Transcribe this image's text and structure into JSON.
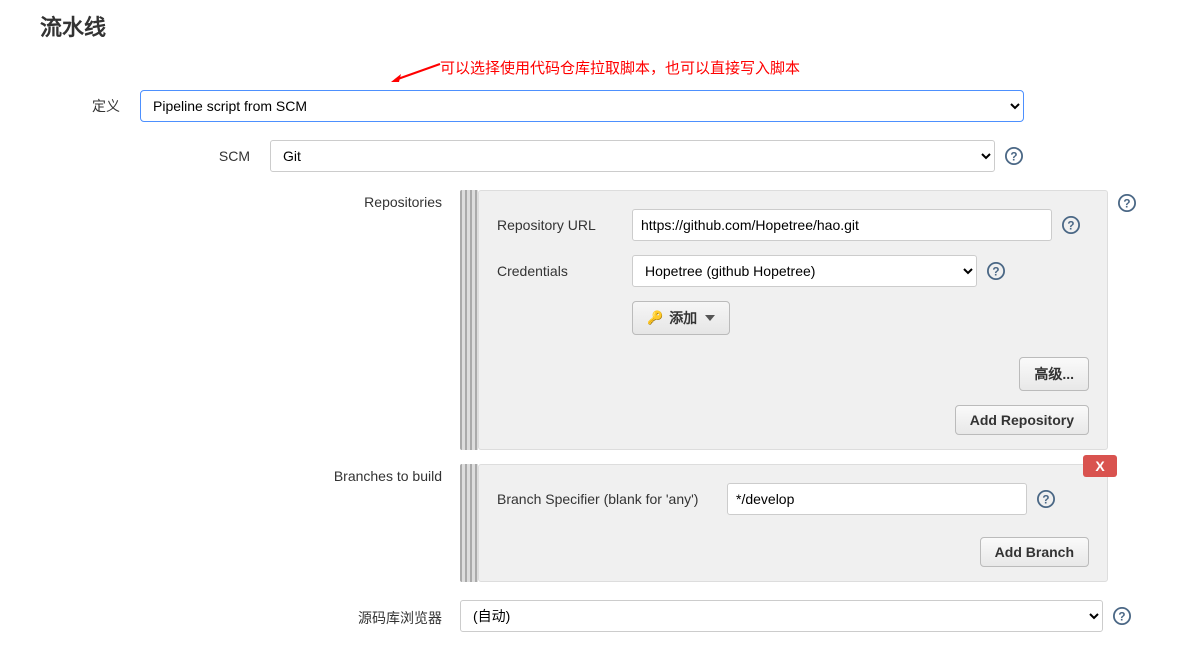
{
  "page_title": "流水线",
  "annotation": "可以选择使用代码仓库拉取脚本，也可以直接写入脚本",
  "definition": {
    "label": "定义",
    "value": "Pipeline script from SCM"
  },
  "scm": {
    "label": "SCM",
    "value": "Git"
  },
  "repositories": {
    "label": "Repositories",
    "repository_url": {
      "label": "Repository URL",
      "value": "https://github.com/Hopetree/hao.git"
    },
    "credentials": {
      "label": "Credentials",
      "value": "Hopetree (github Hopetree)",
      "add_button": "添加"
    },
    "advanced_button": "高级...",
    "add_repository_button": "Add Repository"
  },
  "branches": {
    "label": "Branches to build",
    "branch_specifier": {
      "label": "Branch Specifier (blank for 'any')",
      "value": "*/develop"
    },
    "add_branch_button": "Add Branch",
    "delete_button": "X"
  },
  "repo_browser": {
    "label": "源码库浏览器",
    "value": "(自动)"
  }
}
